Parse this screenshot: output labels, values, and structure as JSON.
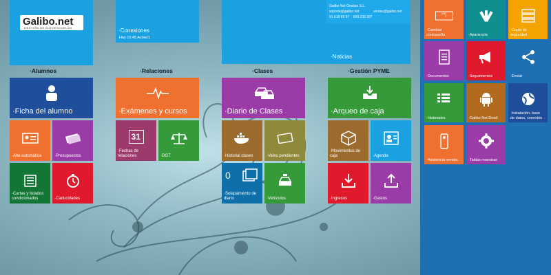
{
  "logo": {
    "brand": "Galibo.net",
    "sub": "GESTIÓN DE AUTOESCUELAS"
  },
  "top": {
    "conexiones_title": "·Conexiones",
    "conexiones_time": "Hoy 15:45 Acme/1",
    "company_name": "Galibo Net Gestion S.L.",
    "email1": "soporte@galibo.net",
    "email2": "ventas@galibo.net",
    "phones": "91 618 69 97    699 233 397",
    "noticias": "·Noticias"
  },
  "sections": {
    "alumnos": "·Alumnos",
    "relaciones": "·Relaciones",
    "clases": "·Clases",
    "gestion": "·Gestión PYME"
  },
  "tiles": {
    "ficha": "·Ficha del alumno",
    "alta": "·Alta automática",
    "presupuestos": "·Presupuestos",
    "cartas": "·Cartas y listados\ncondicionados",
    "caducidades": "·Caducidades",
    "examenes": "·Exámenes y cursos",
    "fechas": "·Fechas de\nrelaciones",
    "dgt": "·DGT",
    "calendar_num": "31",
    "diario": "·Diario de Clases",
    "historial": "·Historial clases",
    "vales": "·Vales pendientes",
    "solapamiento": "·Solapamiento de\ndiario",
    "solap_num": "0",
    "vehiculos": "·Vehículos",
    "arqueo": "·Arqueo de caja",
    "movimientos": "·Movimientos de\ncaja",
    "agenda": "·Agenda",
    "ingresos": "·Ingresos",
    "gastos": "·Gastos"
  },
  "sidebar": {
    "cambiar": "·Cambiar\ncontraseña",
    "apariencia": "·Apariencia",
    "copia": "·Copia de\nseguridad",
    "documentos": "·Documentos",
    "seguimientos": "·Seguimientos",
    "enviar": "·Enviar",
    "historiales": "·Historiales",
    "droid": "·Galibo.Net Droid",
    "instalacion": "·Instalación, base\nde datos, conexión",
    "asistencia": "·Asistencia remota",
    "tablas": "·Tablas maestras",
    "pwd_mask": "**|"
  },
  "colors": {
    "blue": "#1ba1e2",
    "darkblue": "#1f4e9a",
    "orange": "#f0702f",
    "purple": "#9b3ba8",
    "red": "#e0192c",
    "green": "#359b3a",
    "darkgreen": "#137536",
    "brown": "#9c6b2e",
    "olive": "#8f8a3b",
    "teal": "#0f8f8f",
    "yellow": "#f5a300",
    "droid": "#b26b1e"
  }
}
